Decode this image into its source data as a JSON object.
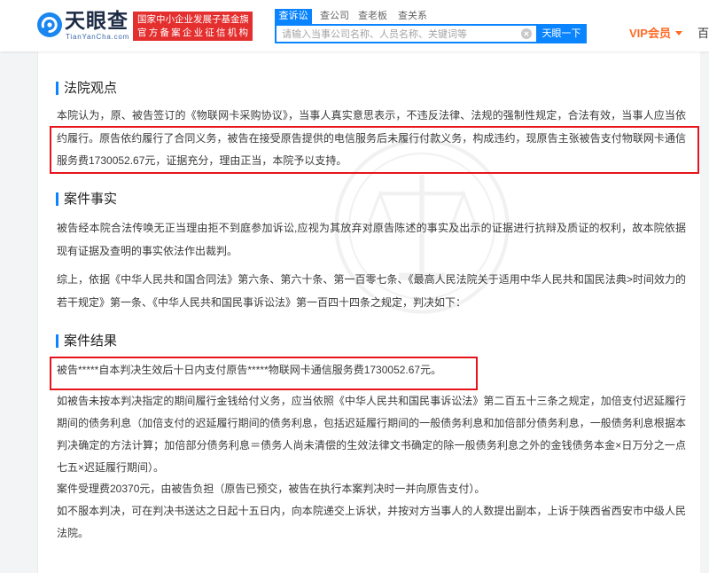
{
  "header": {
    "logo": {
      "icon": "tianyancha-eye-logo-icon",
      "name": "天眼查",
      "domain": "TianYanCha.com"
    },
    "badge": {
      "line1": "国家中小企业发展子基金旗下",
      "line2": "官方备案企业征信机构"
    },
    "tabs": [
      {
        "label": "查诉讼",
        "active": true
      },
      {
        "label": "查公司",
        "active": false
      },
      {
        "label": "查老板",
        "active": false
      },
      {
        "label": "查关系",
        "active": false
      }
    ],
    "search": {
      "value": "",
      "placeholder": "请输入当事公司名称、人员名称、关键词等",
      "clear_icon": "clear-circle-icon",
      "button_label": "天眼一下"
    },
    "vip": {
      "label": "VIP会员",
      "icon": "dropdown-triangle-icon"
    },
    "partial_nav_label": "百"
  },
  "document": {
    "court_opinion": {
      "heading": "法院观点",
      "paragraphs": [
        "本院认为，原、被告签订的《物联网卡采购协议》，当事人真实意思表示，不违反法律、法规的强制性规定，合法有效，当事人应当依约履行。原告依约履行了合同义务，被告在接受原告提供的电信服务后未履行付款义务，构成违约，现原告主张被告支付物联网卡通信服务费1730052.67元，证据充分，理由正当，本院予以支持。"
      ]
    },
    "case_facts": {
      "heading": "案件事实",
      "paragraphs": [
        "被告经本院合法传唤无正当理由拒不到庭参加诉讼,应视为其放弃对原告陈述的事实及出示的证据进行抗辩及质证的权利，故本院依据现有证据及查明的事实依法作出裁判。",
        "综上，依据《中华人民共和国合同法》第六条、第六十条、第一百零七条、《最高人民法院关于适用中华人民共和国民法典>时间效力的若干规定》第一条、《中华人民共和国民事诉讼法》第一百四十四条之规定，判决如下："
      ]
    },
    "case_result": {
      "heading": "案件结果",
      "judgment": "被告*****自本判决生效后十日内支付原告*****物联网卡通信服务费1730052.67元。",
      "paragraphs": [
        "如被告未按本判决指定的期间履行金钱给付义务，应当依照《中华人民共和国民事诉讼法》第二百五十三条之规定，加倍支付迟延履行期间的债务利息（加倍支付的迟延履行期间的债务利息，包括迟延履行期间的一般债务利息和加倍部分债务利息，一般债务利息根据本判决确定的方法计算；加倍部分债务利息＝债务人尚未清偿的生效法律文书确定的除一般债务利息之外的金钱债务本金×日万分之一点七五×迟延履行期间）。",
        "案件受理费20370元，由被告负担（原告已预交，被告在执行本案判决时一并向原告支付）。",
        "如不服本判决，可在判决书送达之日起十五日内，向本院递交上诉状，并按对方当事人的人数提出副本，上诉于陕西省西安市中级人民法院。"
      ]
    }
  },
  "icons": {
    "section_marker": "section-bar-icon",
    "watermark": "court-emblem-watermark-icon"
  },
  "colors": {
    "accent": "#0a84ff",
    "badge_red": "#e42f2f",
    "vip_orange": "#ff6a24",
    "highlight_red": "#e8141b",
    "text": "#3a3a3a",
    "heading": "#222222",
    "page_bg": "#f3f4f6"
  }
}
